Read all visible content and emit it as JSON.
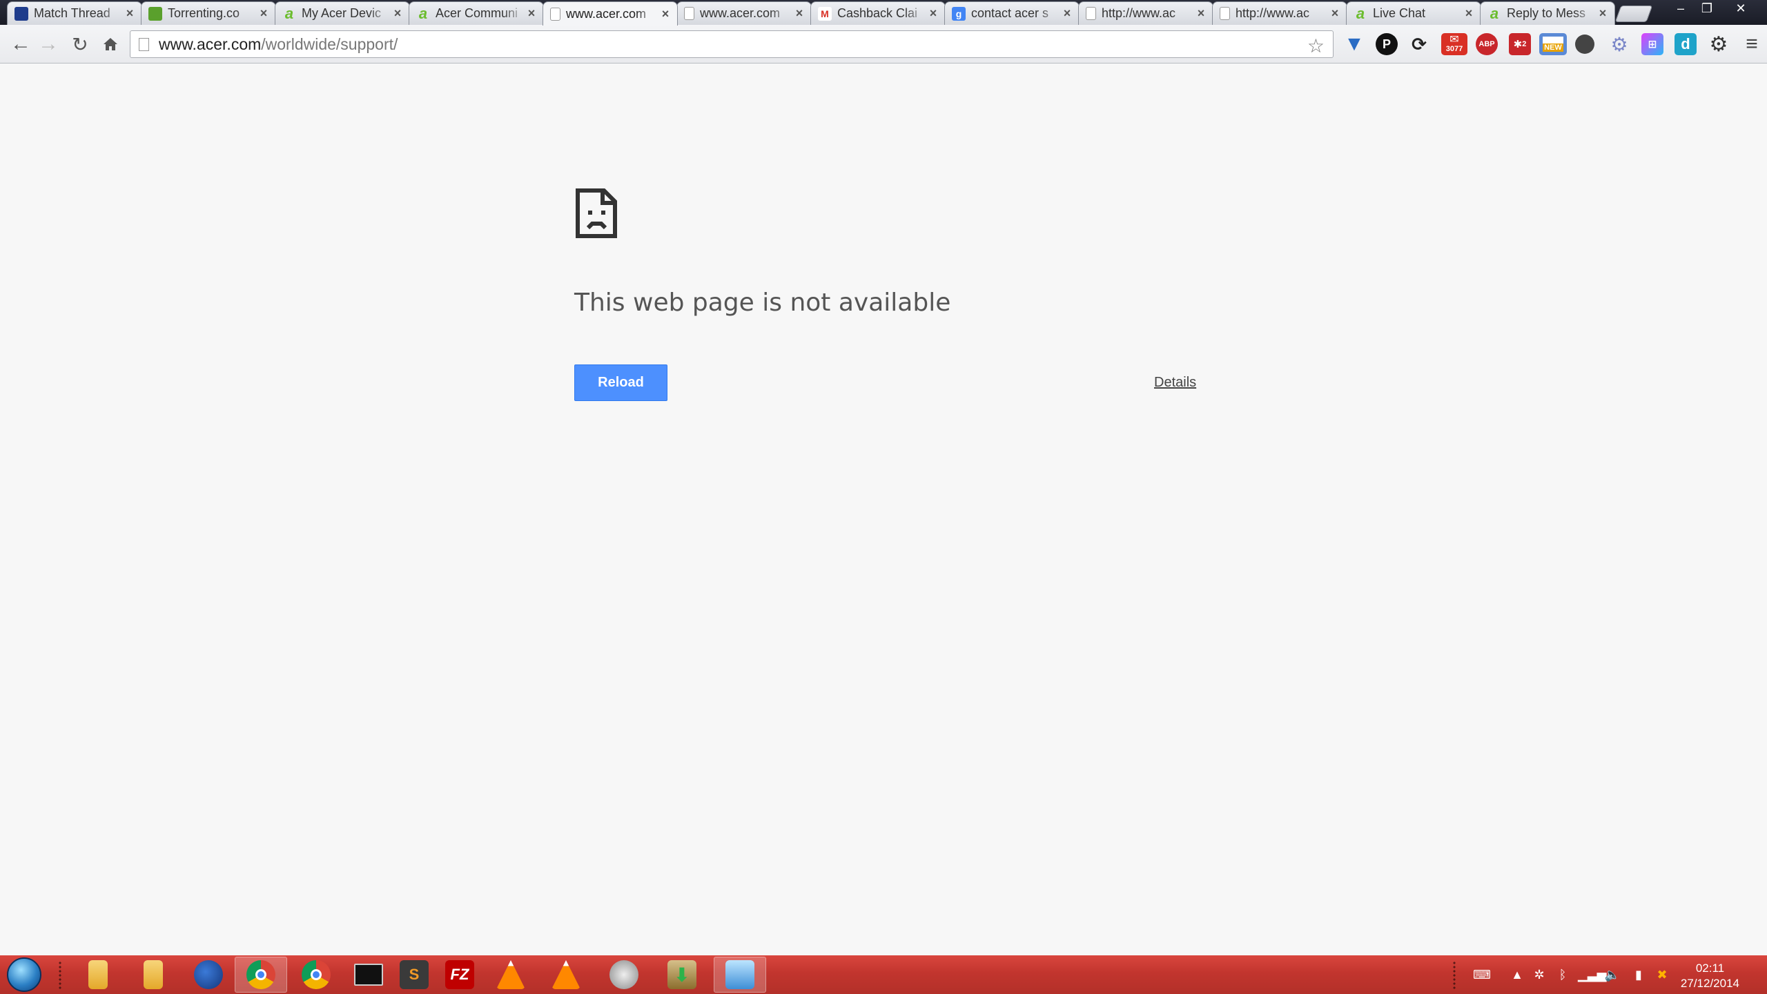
{
  "tabs": [
    {
      "title": "Match Thread",
      "favicon": "match-thread-favicon",
      "fav_color": "#1e3c8c"
    },
    {
      "title": "Torrenting.co",
      "favicon": "torrenting-favicon",
      "fav_color": "#5aa02c"
    },
    {
      "title": "My Acer Devic",
      "favicon": "acer-favicon",
      "fav_color": "#6cbd2f"
    },
    {
      "title": "Acer Communi",
      "favicon": "acer-favicon",
      "fav_color": "#6cbd2f"
    },
    {
      "title": "www.acer.com",
      "favicon": "page-icon",
      "fav_color": "#ffffff",
      "active": true
    },
    {
      "title": "www.acer.com",
      "favicon": "page-icon",
      "fav_color": "#ffffff"
    },
    {
      "title": "Cashback Clai",
      "favicon": "gmail-favicon",
      "fav_color": "#d93025"
    },
    {
      "title": "contact acer s",
      "favicon": "google-favicon",
      "fav_color": "#4285f4"
    },
    {
      "title": "http://www.ac",
      "favicon": "page-icon",
      "fav_color": "#ffffff"
    },
    {
      "title": "http://www.ac",
      "favicon": "page-icon",
      "fav_color": "#ffffff"
    },
    {
      "title": "Live Chat",
      "favicon": "acer-favicon",
      "fav_color": "#6cbd2f"
    },
    {
      "title": "Reply to Mess",
      "favicon": "acer-favicon",
      "fav_color": "#6cbd2f"
    }
  ],
  "address": {
    "host": "www.acer.com",
    "path": "/worldwide/support/"
  },
  "extensions": {
    "gmail_badge": "3077",
    "adblock_label": "ABP",
    "badge_two": "2",
    "new_badge": "NEW",
    "dashlane_letter": "d"
  },
  "error_page": {
    "title": "This web page is not available",
    "reload_label": "Reload",
    "details_label": "Details",
    "icon": "sad-page-icon"
  },
  "taskbar": {
    "sublime_letter": "S",
    "filezilla_letter": "FZ",
    "clock_time": "02:11",
    "clock_date": "27/12/2014"
  },
  "colors": {
    "reload_button": "#4d90fe",
    "taskbar": "#c2352e",
    "page_background": "#f7f7f7"
  }
}
